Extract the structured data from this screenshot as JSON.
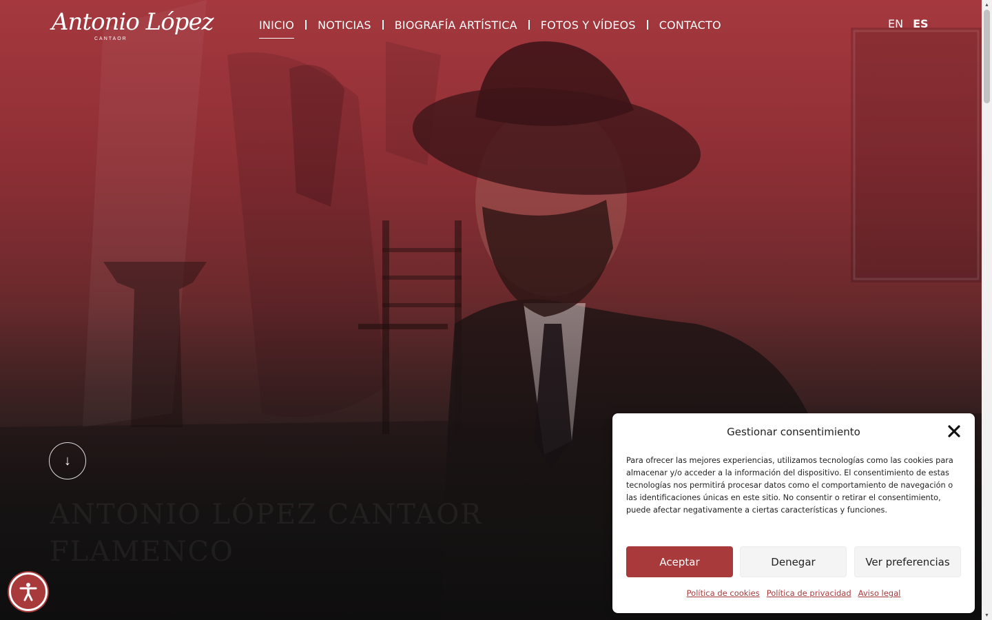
{
  "header": {
    "logo": {
      "script": "Antonio López",
      "subtitle": "CANTAOR"
    },
    "nav": [
      {
        "label": "INICIO",
        "active": true
      },
      {
        "label": "NOTICIAS",
        "active": false
      },
      {
        "label": "BIOGRAFÍA ARTÍSTICA",
        "active": false
      },
      {
        "label": "FOTOS Y VÍDEOS",
        "active": false
      },
      {
        "label": "CONTACTO",
        "active": false
      }
    ],
    "languages": [
      {
        "code": "EN",
        "active": false
      },
      {
        "code": "ES",
        "active": true
      }
    ]
  },
  "hero": {
    "scroll_icon": "arrow-down-icon",
    "scroll_glyph": "↓",
    "heading_line1": "ANTONIO LÓPEZ CANTAOR",
    "heading_line2": "FLAMENCO"
  },
  "consent": {
    "title": "Gestionar consentimiento",
    "text": "Para ofrecer las mejores experiencias, utilizamos tecnologías como las cookies para almacenar y/o acceder a la información del dispositivo. El consentimiento de estas tecnologías nos permitirá procesar datos como el comportamiento de navegación o las identificaciones únicas en este sitio. No consentir o retirar el consentimiento, puede afectar negativamente a ciertas características y funciones.",
    "accept_label": "Aceptar",
    "deny_label": "Denegar",
    "preferences_label": "Ver preferencias",
    "links": [
      "Política de cookies",
      "Política de privacidad",
      "Aviso legal"
    ]
  },
  "colors": {
    "accent": "#a83a3c",
    "hero_top": "#a33a40",
    "hero_bottom": "#141212"
  },
  "icons": {
    "accessibility": "accessibility-icon",
    "close": "close-icon"
  }
}
